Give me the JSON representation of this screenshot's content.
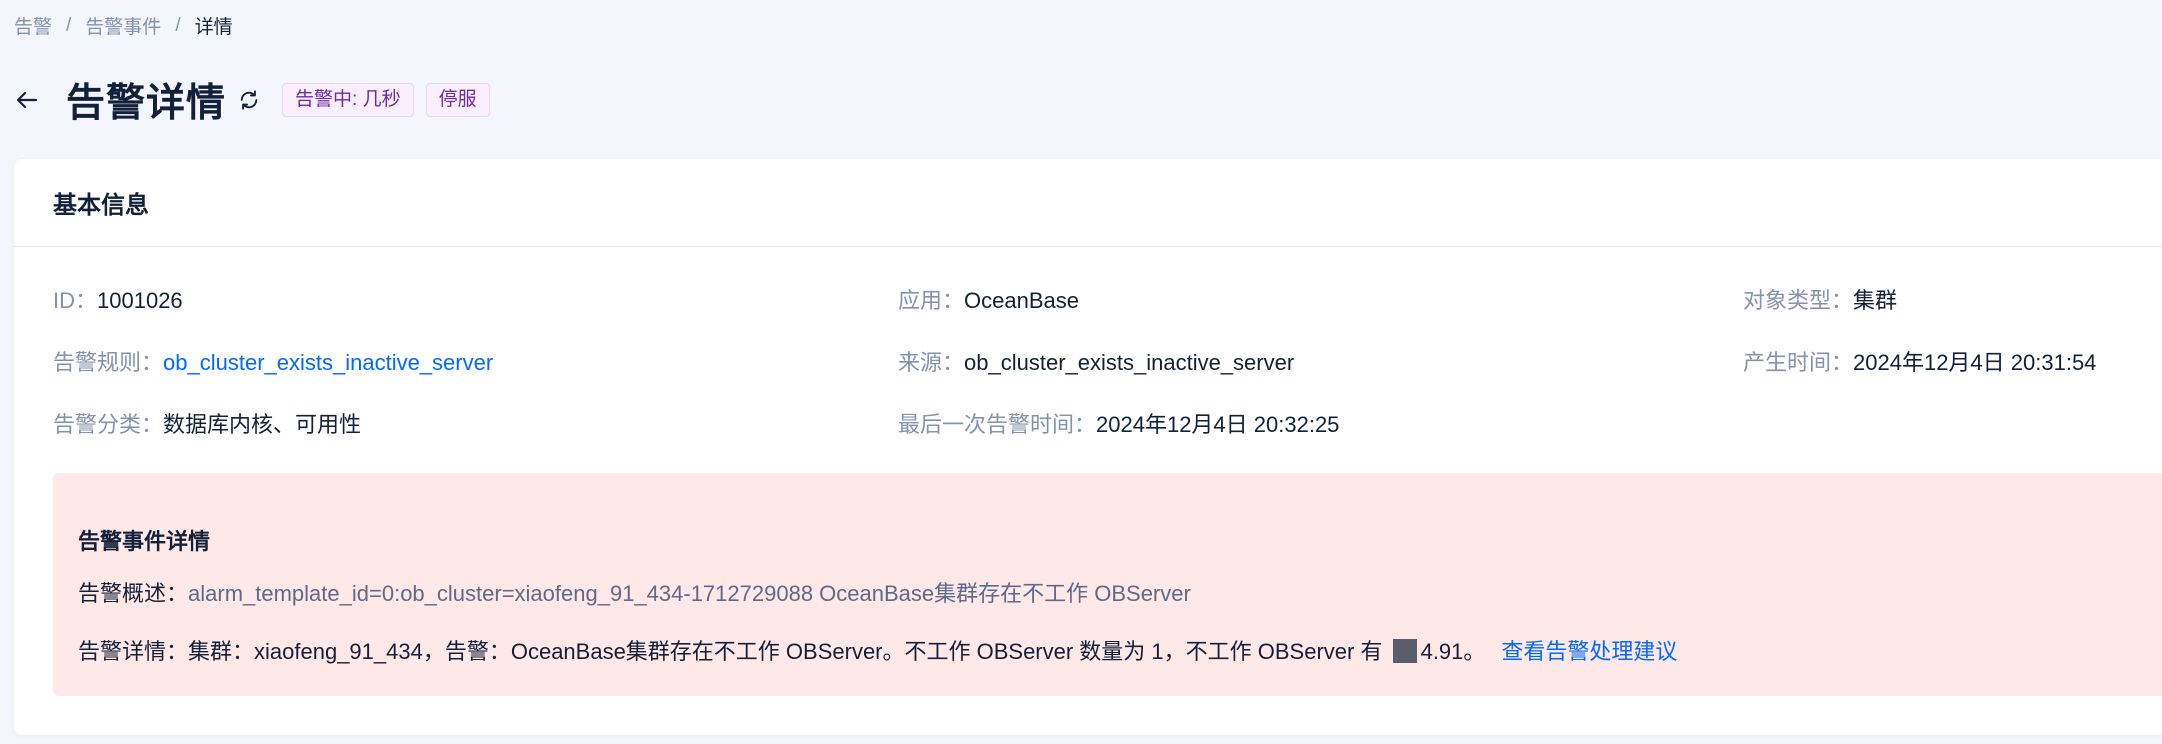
{
  "breadcrumb": {
    "items": [
      "告警",
      "告警事件",
      "详情"
    ],
    "separator": "/"
  },
  "header": {
    "title": "告警详情",
    "status_tag": "告警中: 几秒",
    "service_tag": "停服"
  },
  "basic_info": {
    "title": "基本信息",
    "id": {
      "label": "ID：",
      "value": "1001026"
    },
    "app": {
      "label": "应用：",
      "value": "OceanBase"
    },
    "object_type": {
      "label": "对象类型：",
      "value": "集群"
    },
    "rule": {
      "label": "告警规则：",
      "value": "ob_cluster_exists_inactive_server"
    },
    "source": {
      "label": "来源：",
      "value": "ob_cluster_exists_inactive_server"
    },
    "created_at": {
      "label": "产生时间：",
      "value": "2024年12月4日 20:31:54"
    },
    "category": {
      "label": "告警分类：",
      "value": "数据库内核、可用性"
    },
    "last_alarm": {
      "label": "最后一次告警时间：",
      "value": "2024年12月4日 20:32:25"
    }
  },
  "event_detail": {
    "title": "告警事件详情",
    "summary_label": "告警概述：",
    "summary_value": "alarm_template_id=0:ob_cluster=xiaofeng_91_434-1712729088 OceanBase集群存在不工作 OBServer",
    "detail_label": "告警详情：",
    "detail_value_pre": "集群：xiaofeng_91_434，告警：OceanBase集群存在不工作 OBServer。不工作 OBServer 数量为 1，不工作 OBServer 有 ",
    "detail_value_post": "4.91。",
    "advice_link": "查看告警处理建议"
  },
  "colors": {
    "page_bg": "#f3f6fc",
    "link": "#006aff",
    "alert_bg": "#ffe8e8",
    "tag_bg": "#f9effe",
    "tag_text": "#6e2aa6"
  },
  "icons": {
    "back": "arrow-left-icon",
    "refresh": "refresh-icon"
  }
}
